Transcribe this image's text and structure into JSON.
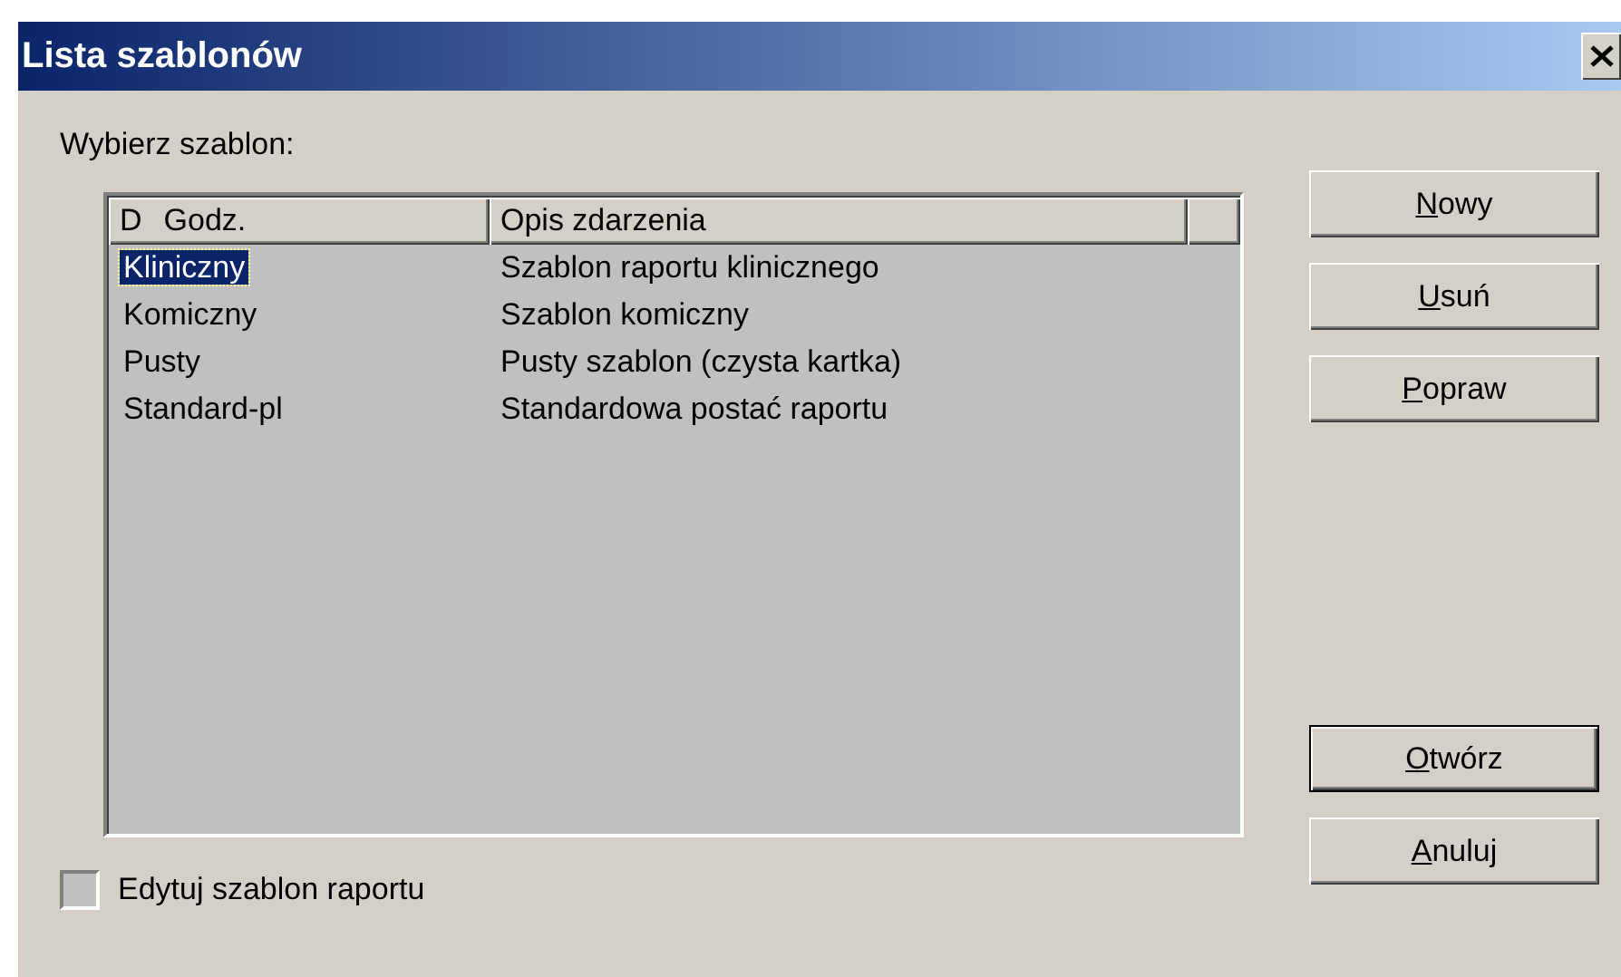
{
  "window": {
    "title": "Lista szablonów"
  },
  "prompt": "Wybierz szablon:",
  "list": {
    "header": [
      {
        "label": "D"
      },
      {
        "label": "Godz."
      },
      {
        "label": "Opis zdarzenia"
      }
    ],
    "rows": [
      {
        "name": "Kliniczny",
        "description": "Szablon raportu klinicznego",
        "selected": true
      },
      {
        "name": "Komiczny",
        "description": "Szablon komiczny",
        "selected": false
      },
      {
        "name": "Pusty",
        "description": "Pusty szablon (czysta kartka)",
        "selected": false
      },
      {
        "name": "Standard-pl",
        "description": "Standardowa postać raportu",
        "selected": false
      }
    ]
  },
  "top_buttons": [
    {
      "label": "Nowy",
      "underline_first": true,
      "default": false
    },
    {
      "label": "Usuń",
      "underline_first": true,
      "default": false
    },
    {
      "label": "Popraw",
      "underline_first": true,
      "default": false
    }
  ],
  "bottom_buttons": [
    {
      "label": "Otwórz",
      "underline_first": true,
      "default": true
    },
    {
      "label": "Anuluj",
      "underline_first": true,
      "default": false
    }
  ],
  "checkbox": {
    "label": "Edytuj szablon raportu",
    "checked": false
  }
}
